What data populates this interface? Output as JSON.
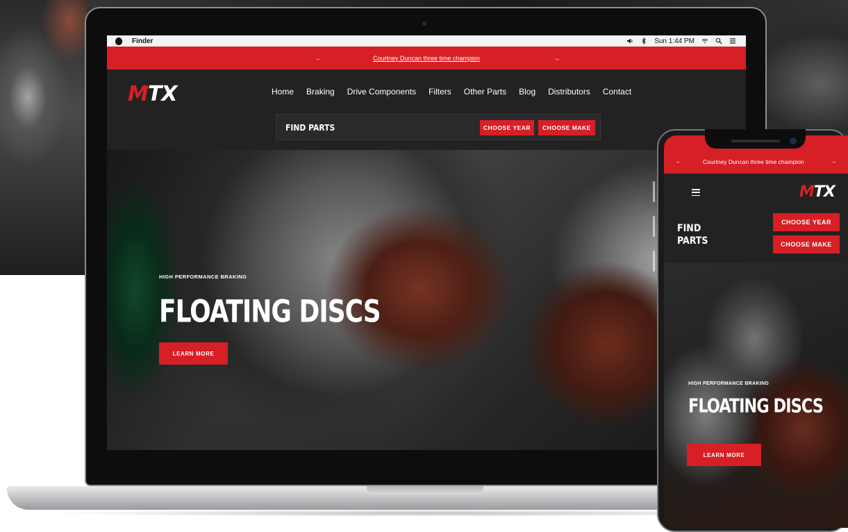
{
  "menubar": {
    "app_name": "Finder",
    "clock": "Sun 1:44 PM"
  },
  "announcement": {
    "prev_arrow": "←",
    "text": "Courtney Duncan three time champion",
    "next_arrow": "→"
  },
  "brand": {
    "logo_m": "M",
    "logo_tx": "TX",
    "accent_color": "#d71f26"
  },
  "nav": {
    "items": [
      "Home",
      "Braking",
      "Drive Components",
      "Filters",
      "Other Parts",
      "Blog",
      "Distributors",
      "Contact"
    ]
  },
  "find_parts": {
    "label": "FIND PARTS",
    "mobile_label_line1": "FIND",
    "mobile_label_line2": "PARTS",
    "choose_year": "CHOOSE YEAR",
    "choose_make": "CHOOSE MAKE"
  },
  "hero": {
    "kicker": "HIGH PERFORMANCE BRAKING",
    "title": "FLOATING DISCS",
    "cta": "LEARN MORE"
  },
  "icons": {
    "apple": "apple-icon",
    "volume": "volume-icon",
    "bluetooth": "bluetooth-icon",
    "wifi": "wifi-icon",
    "search": "search-icon",
    "list": "list-icon",
    "hamburger": "hamburger-menu-icon"
  }
}
